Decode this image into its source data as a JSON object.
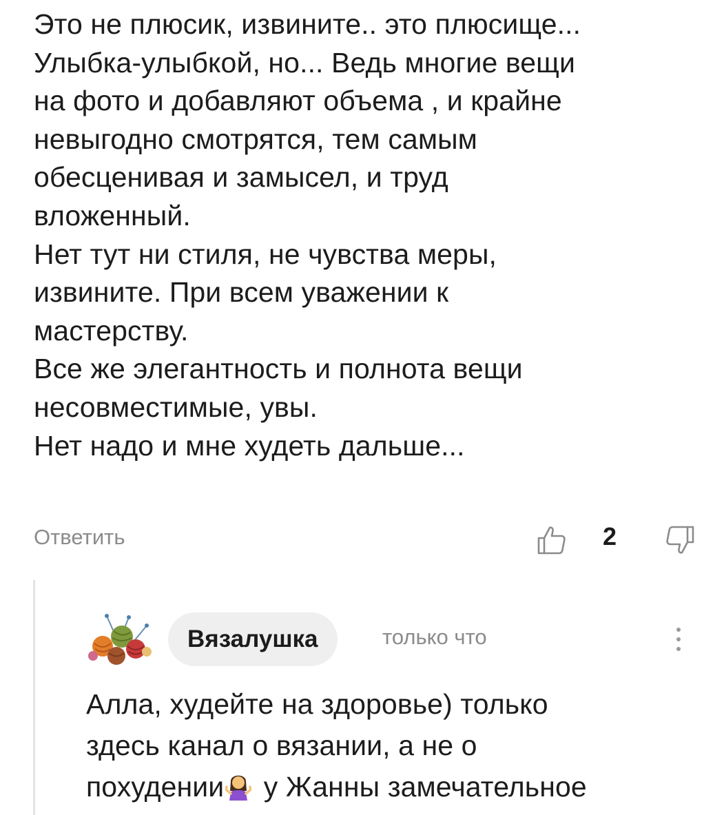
{
  "comment": {
    "lines": [
      "Это не плюсик, извините.. это плюсище...",
      "Улыбка-улыбкой, но... Ведь многие вещи",
      "на фото и добавляют объема , и крайне",
      "невыгодно смотрятся, тем самым",
      "обесценивая и замысел, и труд",
      "вложенный.",
      "Нет тут ни стиля, не чувства меры,",
      "извините. При всем уважении к",
      "мастерству.",
      "Все же элегантность и полнота вещи",
      "несовместимые, увы.",
      "Нет надо и мне худеть дальше..."
    ],
    "reply_label": "Ответить",
    "like_count": "2",
    "like_icon": "thumbs-up-outline-icon",
    "dislike_icon": "thumbs-down-outline-icon"
  },
  "reply": {
    "author": "Вязалушка",
    "timestamp": "только что",
    "avatar_icon": "yarn-balls-avatar-icon",
    "more_icon": "vertical-dots-icon",
    "line1": "Алла, худейте на здоровье) только",
    "line2": "здесь канал о вязании, а не о",
    "line3_before": "похудении",
    "line3_emoji": "woman-shrugging-emoji",
    "line3_after": " у Жанны замечательное"
  },
  "colors": {
    "text": "#1c1c1c",
    "muted": "#8b8b8b",
    "chip_bg": "#efefef",
    "thread_line": "#e2e2e2"
  }
}
